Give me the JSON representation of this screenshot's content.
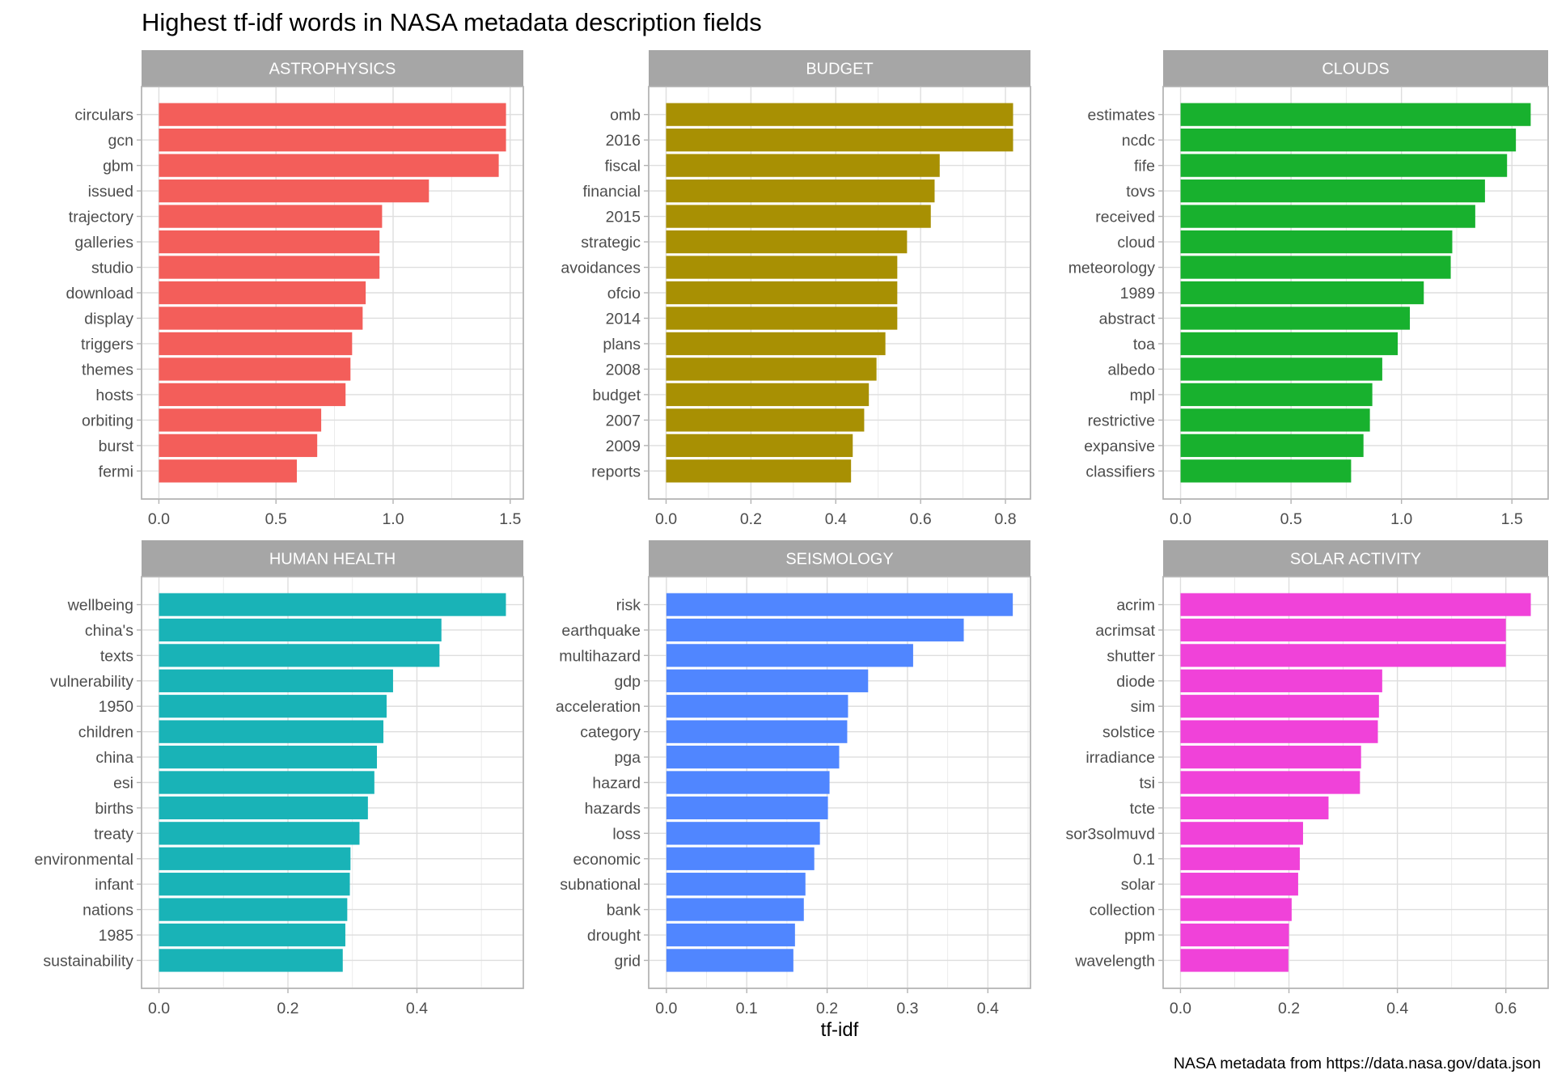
{
  "chart_data": {
    "type": "bar",
    "orientation": "horizontal",
    "title": "Highest tf-idf words in NASA metadata description fields",
    "xlabel": "tf-idf",
    "ylabel": "",
    "caption": "NASA metadata from https://data.nasa.gov/data.json",
    "grid": true,
    "legend": "none",
    "facets": [
      {
        "name": "ASTROPHYSICS",
        "color": "#F35E5A",
        "xticks": [
          0.0,
          0.5,
          1.0,
          1.5
        ],
        "xtick_labels": [
          "0.0",
          "0.5",
          "1.0",
          "1.5"
        ],
        "xlim": [
          -0.074,
          1.556
        ],
        "categories": [
          "circulars",
          "gcn",
          "gbm",
          "issued",
          "trajectory",
          "galleries",
          "studio",
          "download",
          "display",
          "triggers",
          "themes",
          "hosts",
          "orbiting",
          "burst",
          "fermi"
        ],
        "values": [
          1.482,
          1.482,
          1.451,
          1.153,
          0.953,
          0.942,
          0.942,
          0.883,
          0.87,
          0.825,
          0.818,
          0.797,
          0.693,
          0.676,
          0.589
        ]
      },
      {
        "name": "BUDGET",
        "color": "#A89003",
        "xticks": [
          0.0,
          0.2,
          0.4,
          0.6,
          0.8
        ],
        "xtick_labels": [
          "0.0",
          "0.2",
          "0.4",
          "0.6",
          "0.8"
        ],
        "xlim": [
          -0.041,
          0.859
        ],
        "categories": [
          "omb",
          "2016",
          "fiscal",
          "financial",
          "2015",
          "strategic",
          "avoidances",
          "ofcio",
          "2014",
          "plans",
          "2008",
          "budget",
          "2007",
          "2009",
          "reports"
        ],
        "values": [
          0.818,
          0.818,
          0.645,
          0.633,
          0.624,
          0.568,
          0.545,
          0.545,
          0.545,
          0.517,
          0.496,
          0.478,
          0.467,
          0.44,
          0.436
        ]
      },
      {
        "name": "CLOUDS",
        "color": "#18B12E",
        "xticks": [
          0.0,
          0.5,
          1.0,
          1.5
        ],
        "xtick_labels": [
          "0.0",
          "0.5",
          "1.0",
          "1.5"
        ],
        "xlim": [
          -0.079,
          1.664
        ],
        "categories": [
          "estimates",
          "ncdc",
          "fife",
          "tovs",
          "received",
          "cloud",
          "meteorology",
          "1989",
          "abstract",
          "toa",
          "albedo",
          "mpl",
          "restrictive",
          "expansive",
          "classifiers"
        ],
        "values": [
          1.585,
          1.518,
          1.478,
          1.378,
          1.334,
          1.23,
          1.223,
          1.101,
          1.038,
          0.983,
          0.913,
          0.868,
          0.857,
          0.828,
          0.772
        ]
      },
      {
        "name": "HUMAN HEALTH",
        "color": "#19B3B7",
        "xticks": [
          0.0,
          0.2,
          0.4
        ],
        "xtick_labels": [
          "0.0",
          "0.2",
          "0.4"
        ],
        "xlim": [
          -0.027,
          0.565
        ],
        "categories": [
          "wellbeing",
          "china's",
          "texts",
          "vulnerability",
          "1950",
          "children",
          "china",
          "esi",
          "births",
          "treaty",
          "environmental",
          "infant",
          "nations",
          "1985",
          "sustainability"
        ],
        "values": [
          0.538,
          0.438,
          0.435,
          0.363,
          0.353,
          0.348,
          0.338,
          0.334,
          0.324,
          0.311,
          0.297,
          0.296,
          0.292,
          0.289,
          0.285
        ]
      },
      {
        "name": "SEISMOLOGY",
        "color": "#5086FF",
        "xticks": [
          0.0,
          0.1,
          0.2,
          0.3,
          0.4
        ],
        "xtick_labels": [
          "0.0",
          "0.1",
          "0.2",
          "0.3",
          "0.4"
        ],
        "xlim": [
          -0.022,
          0.453
        ],
        "categories": [
          "risk",
          "earthquake",
          "multihazard",
          "gdp",
          "acceleration",
          "category",
          "pga",
          "hazard",
          "hazards",
          "loss",
          "economic",
          "subnational",
          "bank",
          "drought",
          "grid"
        ],
        "values": [
          0.431,
          0.37,
          0.307,
          0.251,
          0.226,
          0.225,
          0.215,
          0.203,
          0.201,
          0.191,
          0.184,
          0.173,
          0.171,
          0.16,
          0.158
        ]
      },
      {
        "name": "SOLAR ACTIVITY",
        "color": "#F042D9",
        "xticks": [
          0.0,
          0.2,
          0.4,
          0.6
        ],
        "xtick_labels": [
          "0.0",
          "0.2",
          "0.4",
          "0.6"
        ],
        "xlim": [
          -0.032,
          0.678
        ],
        "categories": [
          "acrim",
          "acrimsat",
          "shutter",
          "diode",
          "sim",
          "solstice",
          "irradiance",
          "tsi",
          "tcte",
          "sor3solmuvd",
          "0.1",
          "solar",
          "collection",
          "ppm",
          "wavelength"
        ],
        "values": [
          0.646,
          0.6,
          0.6,
          0.372,
          0.366,
          0.364,
          0.333,
          0.331,
          0.273,
          0.226,
          0.22,
          0.217,
          0.205,
          0.2,
          0.199
        ]
      }
    ]
  }
}
